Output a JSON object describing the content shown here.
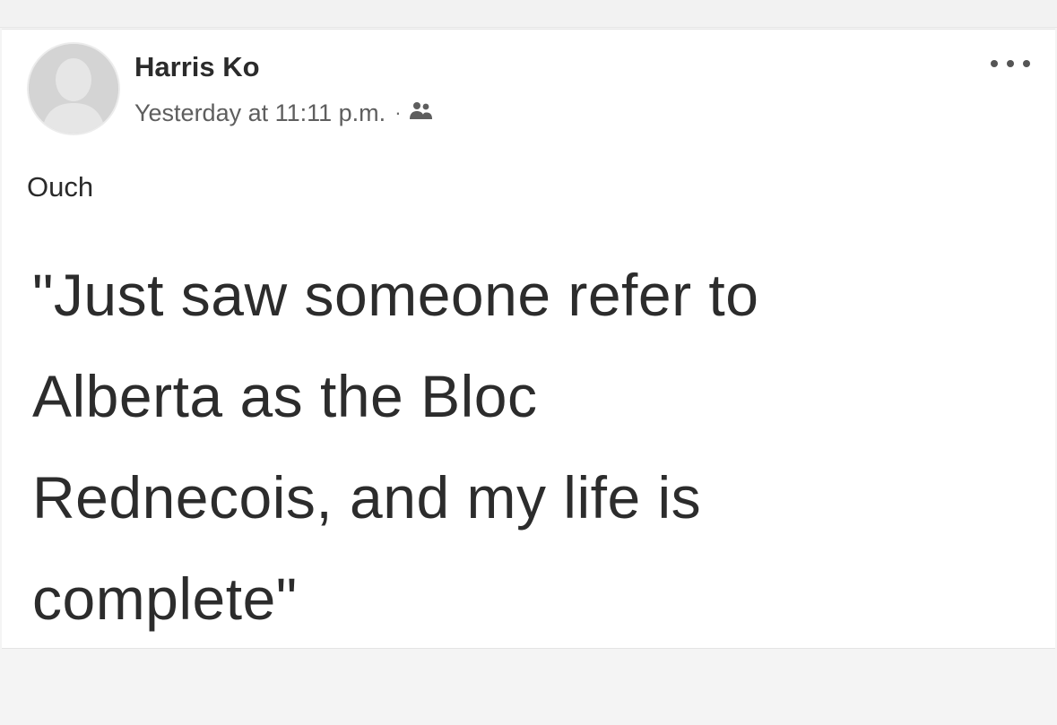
{
  "post": {
    "author": "Harris Ko",
    "timestamp": "Yesterday at 11:11 p.m.",
    "separator": "·",
    "audience_icon": "friends-icon",
    "more_icon": "more-options-icon",
    "caption": "Ouch",
    "body_lines": [
      "\"Just saw someone refer to",
      "Alberta as the Bloc",
      "Rednecois, and my life is",
      "complete\""
    ]
  }
}
